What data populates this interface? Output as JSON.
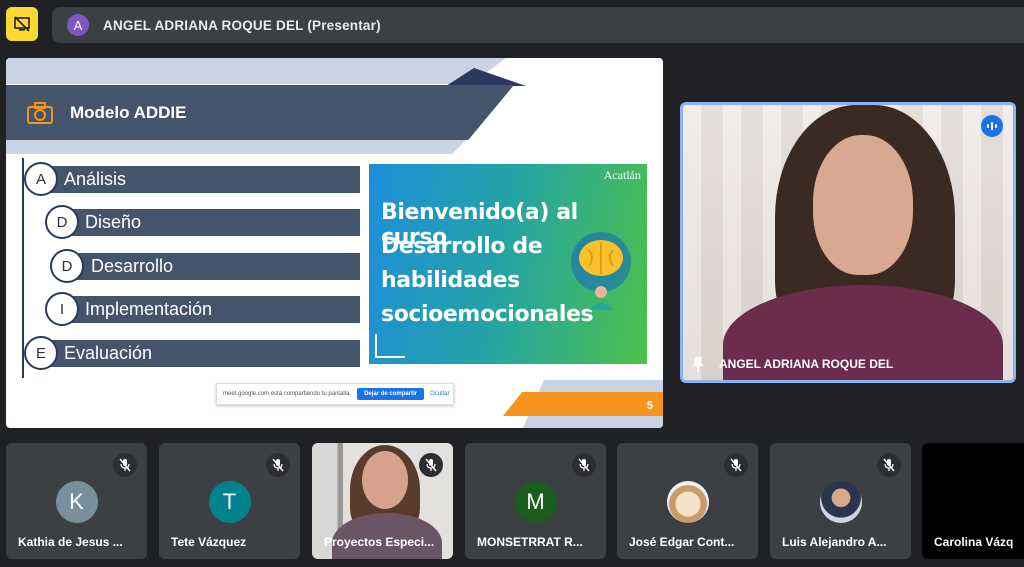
{
  "presenter": {
    "avatar_letter": "A",
    "title": "ANGEL ADRIANA ROQUE DEL (Presentar)"
  },
  "slide": {
    "title": "Modelo ADDIE",
    "phases": [
      {
        "letter": "A",
        "label": "Análisis"
      },
      {
        "letter": "D",
        "label": "Diseño"
      },
      {
        "letter": "D",
        "label": "Desarrollo"
      },
      {
        "letter": "I",
        "label": "Implementación"
      },
      {
        "letter": "E",
        "label": "Evaluación"
      }
    ],
    "banner": {
      "logo": "Acatlán",
      "lines": [
        "Bienvenido(a) al curso",
        "Desarrollo de",
        "habilidades",
        "socioemocionales"
      ]
    },
    "share_bar": {
      "message": "meet.google.com está compartiendo tu pantalla.",
      "stop_label": "Dejar de compartir",
      "hide_label": "Ocultar"
    },
    "page_number": "5"
  },
  "main_video": {
    "name": "ANGEL ADRIANA ROQUE DEL"
  },
  "participants": [
    {
      "name": "Kathia de Jesus ...",
      "avatar_letter": "K",
      "avatar_color": "#78909c",
      "type": "letter"
    },
    {
      "name": "Tete Vázquez",
      "avatar_letter": "T",
      "avatar_color": "#00838f",
      "type": "letter"
    },
    {
      "name": "Proyectos Especi...",
      "type": "video"
    },
    {
      "name": "MONSETRRAT R...",
      "avatar_letter": "M",
      "avatar_color": "#1b5e20",
      "type": "letter"
    },
    {
      "name": "José Edgar Cont...",
      "type": "photo-dog"
    },
    {
      "name": "Luis Alejandro A...",
      "type": "photo-man"
    },
    {
      "name": "Carolina Vázq",
      "type": "dark"
    }
  ],
  "colors": {
    "meet_background": "#202124",
    "tile": "#3c4043",
    "present_button": "#fdd835",
    "slide_bar": "#44546a",
    "active_speaker": "#8ab4f8"
  }
}
